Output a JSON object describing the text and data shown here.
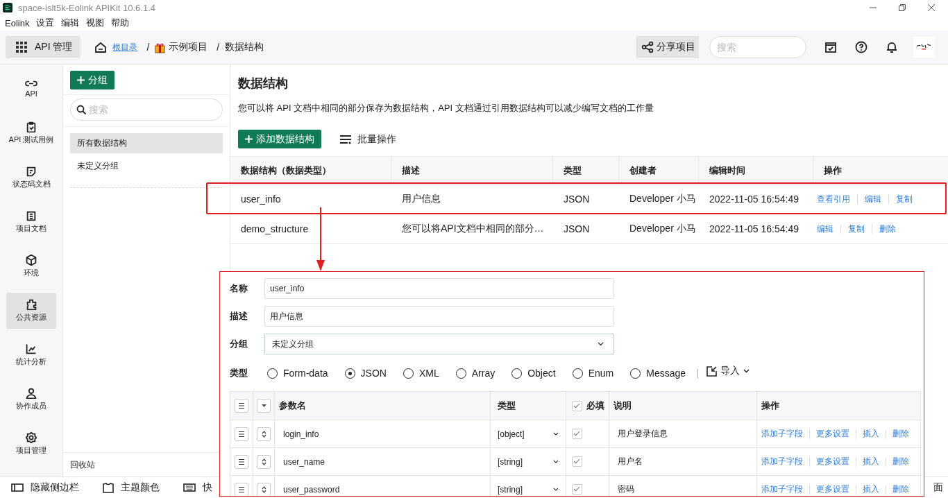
{
  "window": {
    "title": "space-islt5k-Eolink APIKit 10.6.1.4"
  },
  "menu": [
    "Eolink",
    "设置",
    "编辑",
    "视图",
    "帮助"
  ],
  "toolbar": {
    "module": "API 管理",
    "separator": "/",
    "breadcrumb": [
      {
        "label": "根目录",
        "kind": "link"
      },
      {
        "label": "示例项目",
        "kind": "project"
      },
      {
        "label": "数据结构",
        "kind": "text"
      }
    ],
    "share": "分享项目",
    "search": {
      "placeholder": "搜索"
    }
  },
  "nav": [
    {
      "label": "API",
      "selected": false
    },
    {
      "label": "API 测试用例",
      "selected": false
    },
    {
      "label": "状态码文档",
      "selected": false
    },
    {
      "label": "项目文档",
      "selected": false
    },
    {
      "label": "环境",
      "selected": false
    },
    {
      "label": "公共资源",
      "selected": true
    },
    {
      "label": "统计分析",
      "selected": false
    },
    {
      "label": "协作成员",
      "selected": false
    },
    {
      "label": "项目管理",
      "selected": false
    }
  ],
  "groups": {
    "add": "分组",
    "search": {
      "placeholder": "搜索"
    },
    "items": [
      {
        "label": "所有数据结构",
        "selected": true
      },
      {
        "label": "未定义分组",
        "selected": false
      }
    ],
    "trash": "回收站"
  },
  "bottom_bar": [
    "隐藏侧边栏",
    "主题颜色",
    "快",
    "面"
  ],
  "page": {
    "title": "数据结构",
    "description": "您可以将 API 文档中相同的部分保存为数据结构，API 文档通过引用数据结构可以减少编写文档的工作量",
    "add_button": "添加数据结构",
    "batch": "批量操作",
    "table": {
      "columns": [
        "数据结构（数据类型）",
        "描述",
        "类型",
        "创建者",
        "编辑时间",
        "操作"
      ],
      "rows": [
        {
          "cells": [
            "user_info",
            "用户信息",
            "JSON",
            "Developer 小马",
            "2022-11-05 16:54:49"
          ],
          "actions": [
            "查看引用",
            "编辑",
            "复制"
          ],
          "highlighted": true
        },
        {
          "cells": [
            "demo_structure",
            "您可以将API文档中相同的部分…",
            "JSON",
            "Developer 小马",
            "2022-11-05 16:54:49"
          ],
          "actions": [
            "编辑",
            "复制",
            "删除"
          ],
          "highlighted": false
        }
      ]
    }
  },
  "editor": {
    "fields": [
      {
        "label": "名称",
        "value": "user_info",
        "kind": "text"
      },
      {
        "label": "描述",
        "value": "用户信息",
        "kind": "text"
      },
      {
        "label": "分组",
        "value": "未定义分组",
        "kind": "select"
      }
    ],
    "type_label": "类型",
    "types": [
      {
        "label": "Form-data",
        "selected": false
      },
      {
        "label": "JSON",
        "selected": true
      },
      {
        "label": "XML",
        "selected": false
      },
      {
        "label": "Array",
        "selected": false
      },
      {
        "label": "Object",
        "selected": false
      },
      {
        "label": "Enum",
        "selected": false
      },
      {
        "label": "Message",
        "selected": false
      }
    ],
    "import": "导入",
    "params": {
      "columns": [
        "参数名",
        "类型",
        "必填",
        "说明",
        "操作"
      ],
      "required_all": true,
      "rows": [
        {
          "name": "login_info",
          "type": "[object]",
          "required": true,
          "description": "用户登录信息",
          "actions": [
            "添加子字段",
            "更多设置",
            "插入",
            "删除"
          ]
        },
        {
          "name": "user_name",
          "type": "[string]",
          "required": true,
          "description": "用户名",
          "actions": [
            "添加子字段",
            "更多设置",
            "插入",
            "删除"
          ]
        },
        {
          "name": "user_password",
          "type": "[string]",
          "required": true,
          "description": "密码",
          "actions": [
            "添加子字段",
            "更多设置",
            "插入",
            "删除"
          ]
        }
      ]
    }
  }
}
